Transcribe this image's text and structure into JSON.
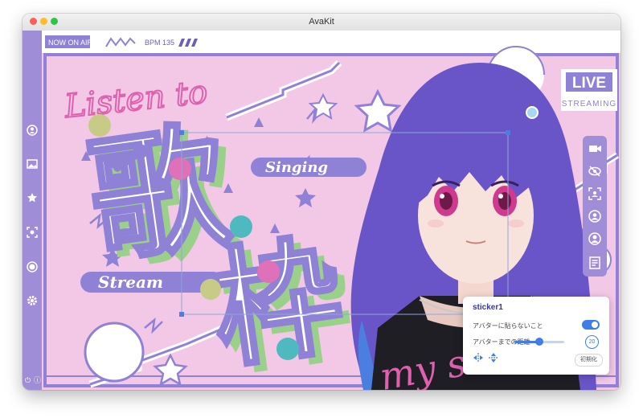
{
  "window": {
    "title": "AvaKit"
  },
  "top_bar": {
    "now_on_air": "NOW ON AIR",
    "bpm": "BPM 135"
  },
  "badge": {
    "live": "LIVE",
    "streaming": "STREAMING"
  },
  "artwork": {
    "script_text": "Listen to",
    "kanji_top": "歌",
    "kanji_bottom": "枠",
    "singing": "Singing",
    "stream": "Stream",
    "bottom_script": "my s"
  },
  "sidebar": {
    "items": [
      "user-icon",
      "image-icon",
      "star-icon",
      "face-scan-icon",
      "record-icon",
      "settings-icon"
    ],
    "bottom_power": "⏻",
    "bottom_info": "ⓘ"
  },
  "toolbar": {
    "items": [
      "camera-icon",
      "eye-off-icon",
      "scan-icon",
      "avatar-refresh-icon",
      "avatar-icon"
    ],
    "extra": "layout-icon"
  },
  "sticker_panel": {
    "title": "sticker1",
    "no_stick_label": "アバターに貼らないこと",
    "no_stick_on": true,
    "distance_label": "アバターまでの距離",
    "distance_value": "20",
    "distance_fraction": 0.5,
    "reset_label": "初期化"
  },
  "colors": {
    "accent": "#3f7de8",
    "sidebar": "#a08dd8",
    "background": "#f3c8e6",
    "purple": "#8f81d6",
    "pink": "#e060b0"
  }
}
